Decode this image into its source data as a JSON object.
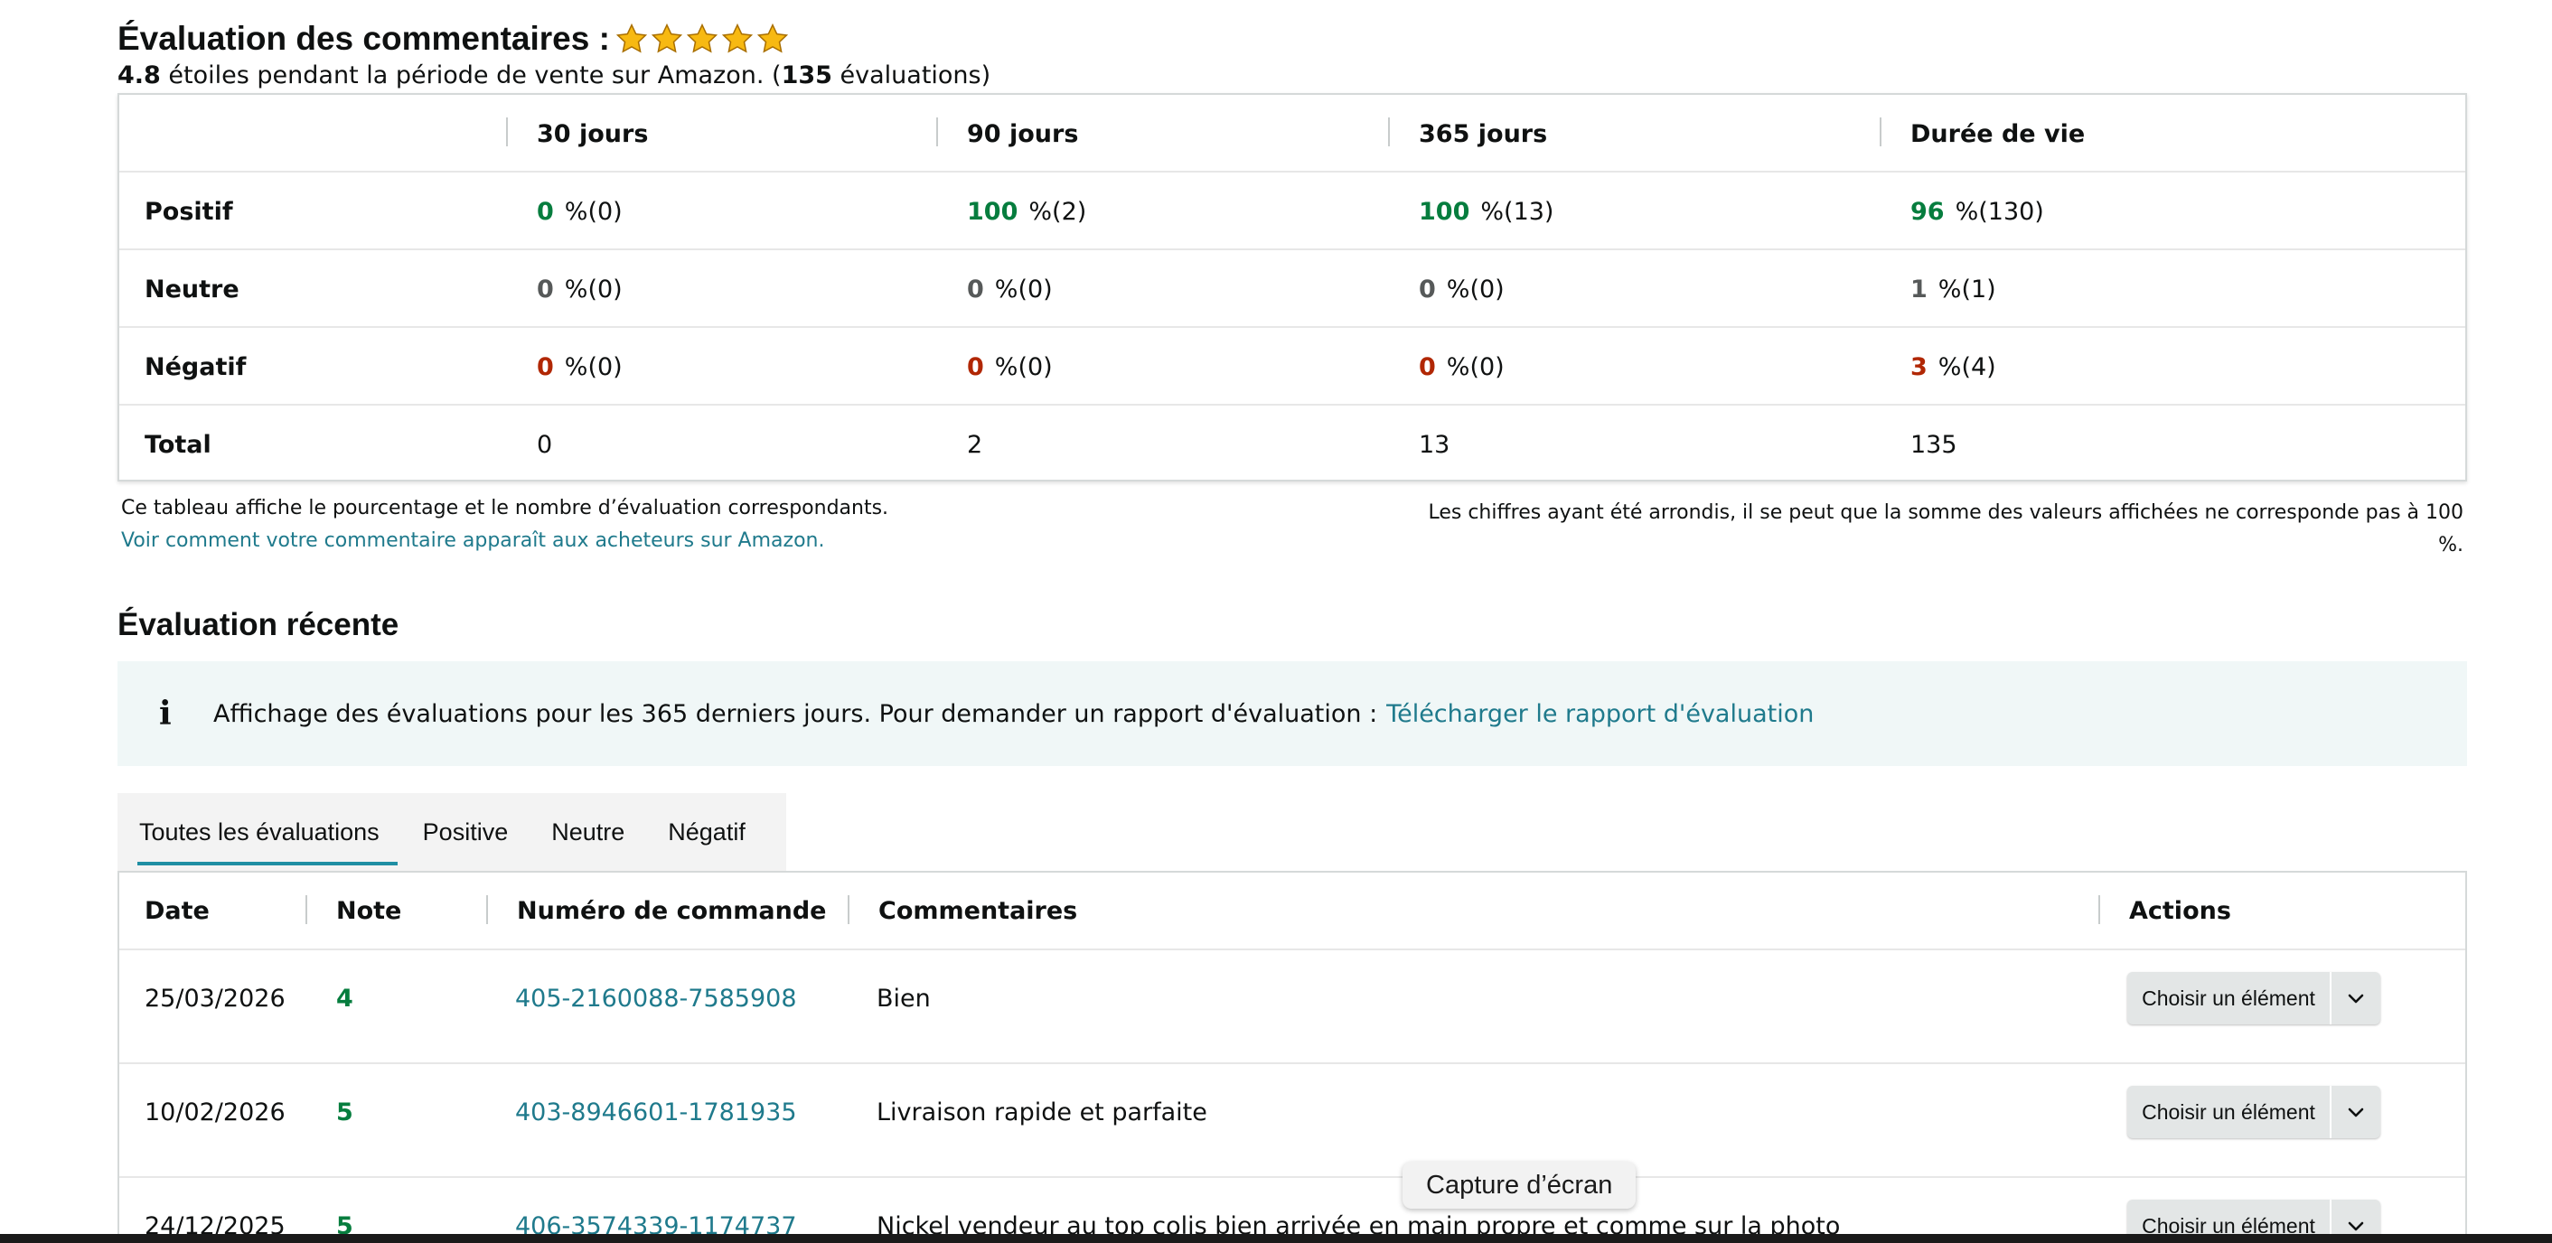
{
  "header": {
    "title": "Évaluation des commentaires :",
    "star_count": 5,
    "star_color": "#f7b912",
    "rating": "4.8",
    "subline_text": " étoiles pendant la période de vente sur Amazon. (",
    "review_count": "135",
    "reviews_suffix": " évaluations)"
  },
  "summary": {
    "columns": [
      "30 jours",
      "90 jours",
      "365 jours",
      "Durée de vie"
    ],
    "rows": [
      {
        "label": "Positif",
        "cells": [
          {
            "pct": "0",
            "rest": "%(0)",
            "tone": "g"
          },
          {
            "pct": "100",
            "rest": "%(2)",
            "tone": "g"
          },
          {
            "pct": "100",
            "rest": "%(13)",
            "tone": "g"
          },
          {
            "pct": "96",
            "rest": "%(130)",
            "tone": "g"
          }
        ]
      },
      {
        "label": "Neutre",
        "cells": [
          {
            "pct": "0",
            "rest": "%(0)",
            "tone": "n"
          },
          {
            "pct": "0",
            "rest": "%(0)",
            "tone": "n"
          },
          {
            "pct": "0",
            "rest": "%(0)",
            "tone": "n"
          },
          {
            "pct": "1",
            "rest": "%(1)",
            "tone": "n"
          }
        ]
      },
      {
        "label": "Négatif",
        "cells": [
          {
            "pct": "0",
            "rest": "%(0)",
            "tone": "r"
          },
          {
            "pct": "0",
            "rest": "%(0)",
            "tone": "r"
          },
          {
            "pct": "0",
            "rest": "%(0)",
            "tone": "r"
          },
          {
            "pct": "3",
            "rest": "%(4)",
            "tone": "r"
          }
        ]
      },
      {
        "label": "Total",
        "cells": [
          "0",
          "2",
          "13",
          "135"
        ]
      }
    ],
    "note_left": "Ce tableau affiche le pourcentage et le nombre d’évaluation correspondants.",
    "link_left": "Voir comment votre commentaire apparaît aux acheteurs sur Amazon.",
    "note_right": "Les chiffres ayant été arrondis, il se peut que la somme des valeurs affichées ne corresponde pas à 100 %."
  },
  "recent": {
    "title": "Évaluation récente",
    "info_icon": "info-icon",
    "info_text": "Affichage des évaluations pour les 365 derniers jours. Pour demander un rapport d'évaluation :",
    "info_link": "Télécharger le rapport d'évaluation",
    "tabs": [
      "Toutes les évaluations",
      "Positive",
      "Neutre",
      "Négatif"
    ],
    "active_tab": 0
  },
  "feedback_table": {
    "headers": [
      "Date",
      "Note",
      "Numéro de commande",
      "Commentaires",
      "Actions"
    ],
    "action_label": "Choisir un élément",
    "rows": [
      {
        "date": "25/03/2026",
        "note": "4",
        "order": "405-2160088-7585908",
        "comment": "Bien"
      },
      {
        "date": "10/02/2026",
        "note": "5",
        "order": "403-8946601-1781935",
        "comment": "Livraison rapide et parfaite"
      },
      {
        "date": "24/12/2025",
        "note": "5",
        "order": "406-3574339-1174737",
        "comment": "Nickel vendeur au top colis bien arrivée en main propre et comme sur la photo"
      }
    ]
  },
  "tooltip": "Capture d’écran"
}
